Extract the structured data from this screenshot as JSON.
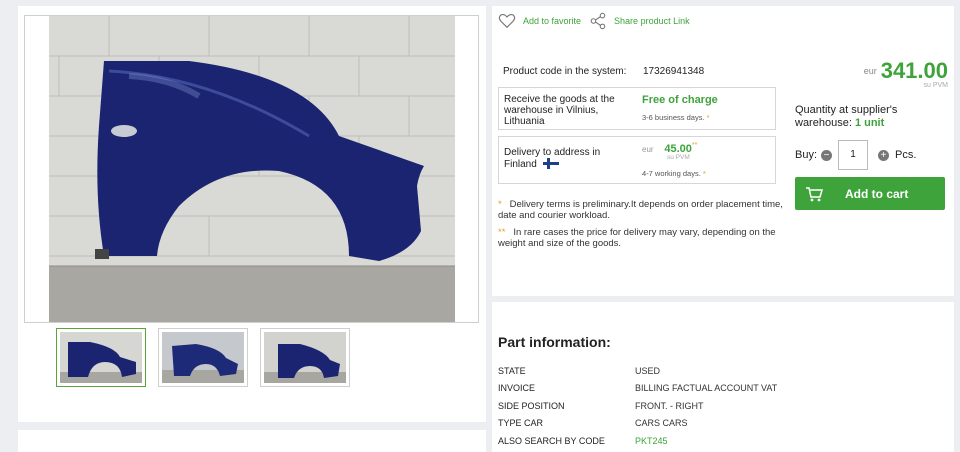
{
  "actions": {
    "favorite_label": "Add to favorite",
    "share_label": "Share product Link"
  },
  "product": {
    "code_label": "Product code in the system:",
    "code_value": "17326941348",
    "currency": "eur",
    "price": "341.00",
    "vat_note": "su PVM"
  },
  "pickup": {
    "label": "Receive the goods at the warehouse in Vilnius, Lithuania",
    "price_text": "Free of charge",
    "days": "3-6 business days.",
    "mark": "*"
  },
  "delivery": {
    "label": "Delivery to address in Finland",
    "currency": "eur",
    "price": "45.00",
    "price_mark": "**",
    "vat_note": "su PVM",
    "days": "4-7 working days.",
    "mark": "*",
    "flag": "finland-flag-icon"
  },
  "notes": [
    {
      "mark": "*",
      "text": "Delivery terms is preliminary.It depends on order placement time, date and courier workload."
    },
    {
      "mark": "**",
      "text": "In rare cases the price for delivery may vary, depending on the weight and size of the goods."
    }
  ],
  "stock": {
    "label": "Quantity at supplier's warehouse:",
    "value": "1 unit"
  },
  "buy": {
    "label": "Buy:",
    "quantity": "1",
    "unit": "Pcs.",
    "minus": "−",
    "plus": "+",
    "cart_button": "Add to cart"
  },
  "info": {
    "title": "Part information:",
    "rows": [
      {
        "key": "STATE",
        "value": "USED"
      },
      {
        "key": "INVOICE",
        "value": "BILLING FACTUAL ACCOUNT VAT"
      },
      {
        "key": "SIDE POSITION",
        "value": "FRONT. - RIGHT"
      },
      {
        "key": "TYPE CAR",
        "value": "CARS CARS"
      },
      {
        "key": "ALSO SEARCH BY CODE",
        "value": "PKT245"
      }
    ]
  },
  "colors": {
    "accent": "#3ea33a",
    "part_color": "#1a2470",
    "note_mark": "#e59d2c"
  },
  "icons": {
    "favorite": "heart-icon",
    "share": "share-icon",
    "cart": "cart-icon"
  }
}
